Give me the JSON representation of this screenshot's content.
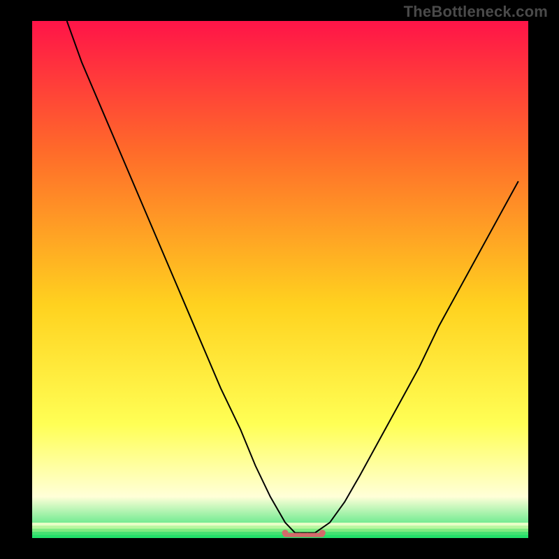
{
  "watermark": "TheBottleneck.com",
  "colors": {
    "gradient_top": "#ff1448",
    "gradient_mid1": "#ff6a2a",
    "gradient_mid2": "#ffd21f",
    "gradient_mid3": "#ffff55",
    "gradient_bottom": "#ffffd8",
    "bottom_band": "#23e06a",
    "marker": "#d46a6a",
    "curve": "#000000",
    "frame": "#000000"
  },
  "chart_data": {
    "type": "line",
    "title": "",
    "xlabel": "",
    "ylabel": "",
    "xlim": [
      0,
      100
    ],
    "ylim": [
      0,
      100
    ],
    "series": [
      {
        "name": "bottleneck-curve",
        "x": [
          7,
          10,
          14,
          18,
          22,
          26,
          30,
          34,
          38,
          42,
          45,
          48,
          51,
          53,
          55,
          57,
          60,
          63,
          66,
          70,
          74,
          78,
          82,
          86,
          90,
          94,
          98
        ],
        "values": [
          100,
          92,
          83,
          74,
          65,
          56,
          47,
          38,
          29,
          21,
          14,
          8,
          3,
          1,
          1,
          1,
          3,
          7,
          12,
          19,
          26,
          33,
          41,
          48,
          55,
          62,
          69
        ]
      }
    ],
    "annotations": [
      {
        "name": "optimal-marker",
        "type": "segment",
        "x0": 51,
        "x1": 58.5,
        "y": 1,
        "endpoints": true
      }
    ],
    "background": {
      "type": "vertical-gradient",
      "stops": [
        {
          "pos": 0.0,
          "color": "#ff1448"
        },
        {
          "pos": 0.25,
          "color": "#ff6a2a"
        },
        {
          "pos": 0.55,
          "color": "#ffd21f"
        },
        {
          "pos": 0.78,
          "color": "#ffff55"
        },
        {
          "pos": 0.92,
          "color": "#ffffd8"
        },
        {
          "pos": 1.0,
          "color": "#23e06a"
        }
      ]
    },
    "grid": false,
    "legend": false
  }
}
